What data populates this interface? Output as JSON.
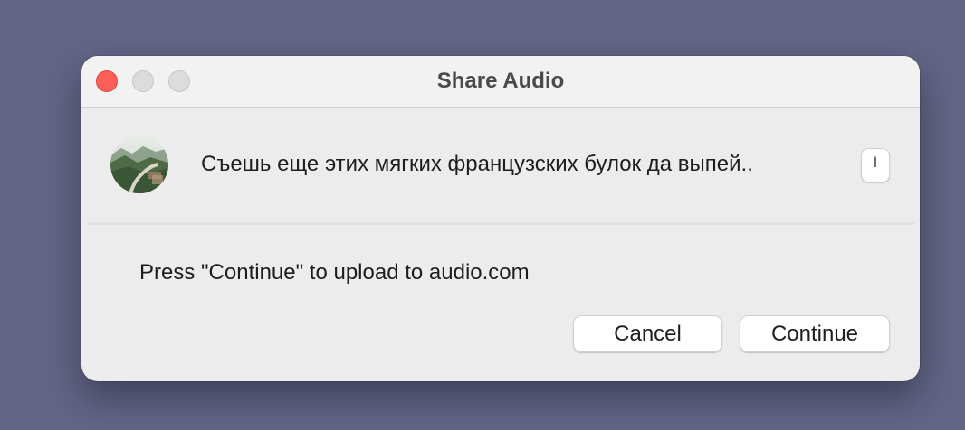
{
  "window": {
    "title": "Share Audio",
    "controls": [
      "close",
      "minimize",
      "maximize"
    ]
  },
  "audio": {
    "title": "Съешь еще этих мягких французских булок да выпей..",
    "action_glyph": "ˡ"
  },
  "message": "Press \"Continue\" to upload to audio.com",
  "buttons": {
    "cancel": "Cancel",
    "continue": "Continue"
  },
  "colors": {
    "close": "#fe5f57",
    "inactive_control": "#dcdcdc",
    "desktop": "#626585"
  }
}
